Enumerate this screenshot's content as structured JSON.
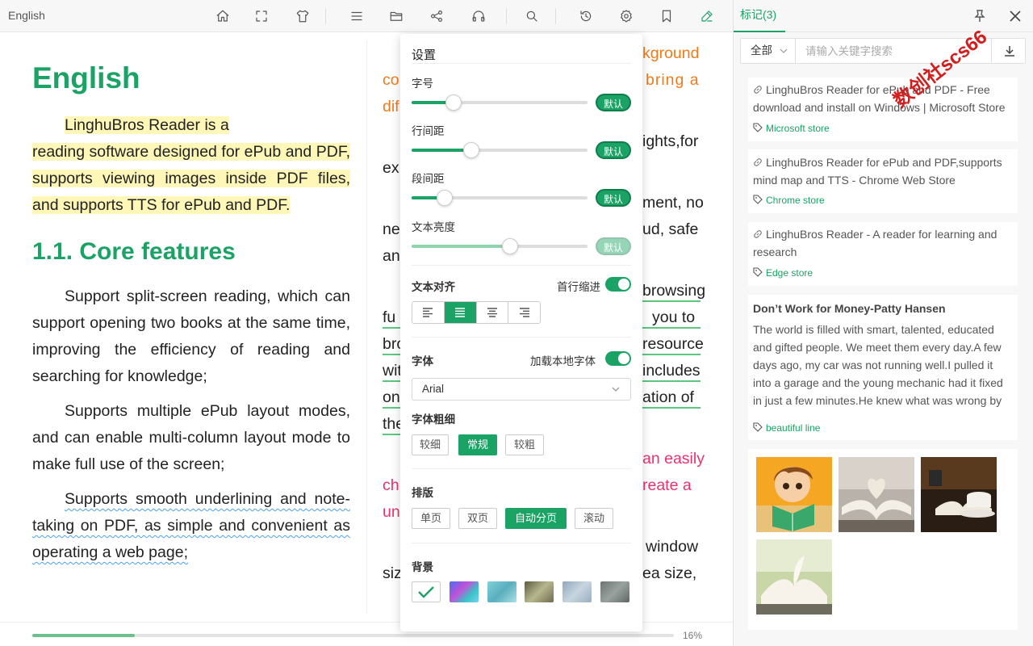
{
  "topbar": {
    "title": "English",
    "icons": [
      "home-icon",
      "fullscreen-icon",
      "theme-icon",
      "menu-icon",
      "folder-icon",
      "share-icon",
      "headphones-icon",
      "search-icon",
      "history-icon",
      "settings-icon",
      "bookmark-icon",
      "pen-icon"
    ]
  },
  "reader": {
    "heading": "English",
    "intro_first": "LinghuBros Reader is a",
    "intro_rest": "reading software designed for ePub and PDF, supports viewing images inside PDF files, and supports TTS for ePub and PDF.",
    "subheading": "1.1. Core features",
    "p1": "Support split-screen reading, which can support opening two books at the same time, improving the efficiency of reading and searching for knowledge;",
    "p2": "Supports multiple ePub layout modes, and can enable multi-column layout mode to make full use of the screen;",
    "p3": "Supports smooth underlining and note-taking on PDF, as simple and convenient as operating a web page;",
    "right_fragments": {
      "r1": "kground",
      "r2a": "co",
      "r2b": "bring a",
      "r3": "dif",
      "r4": "ights,for",
      "r5": "ex",
      "r6": "ment, no",
      "r7a": "ne",
      "r7b": "ud, safe",
      "r8": "an",
      "r9": "browsing",
      "r10a": "fu",
      "r10b": "you to",
      "r11a": "bro",
      "r11b": "resource",
      "r12a": "wit",
      "r12b": "includes",
      "r13a": "on",
      "r13b": "ation of",
      "r14": "the",
      "r15": "an easily",
      "r16a": "ch",
      "r16b": "reate a",
      "r17": "un",
      "r18": "window",
      "r19a": "siz",
      "r19b": "ea size,"
    }
  },
  "progress": {
    "percent_label": "16%",
    "fraction": 0.16
  },
  "settings": {
    "title": "设置",
    "font_size_label": "字号",
    "line_spacing_label": "行间距",
    "para_spacing_label": "段间距",
    "brightness_label": "文本亮度",
    "default_label": "默认",
    "sliders": {
      "font_size": 0.24,
      "line_spacing": 0.34,
      "para_spacing": 0.19,
      "brightness": 0.56
    },
    "text_align_label": "文本对齐",
    "first_indent_label": "首行缩进",
    "font_label": "字体",
    "load_local_font_label": "加载本地字体",
    "font_value": "Arial",
    "font_weight_label": "字体粗细",
    "weights": [
      "较细",
      "常规",
      "较粗"
    ],
    "layout_label": "排版",
    "layouts": [
      "单页",
      "双页",
      "自动分页",
      "滚动"
    ],
    "background_label": "背景"
  },
  "panel": {
    "title": "标记(3)",
    "filter_label": "全部",
    "search_placeholder": "请输入关键字搜索",
    "cards": [
      {
        "text": "LinghuBros Reader for ePub and PDF - Free download and install on Windows | Microsoft Store",
        "tag": "Microsoft store"
      },
      {
        "text": "LinghuBros Reader for ePub and PDF,supports mind map and TTS - Chrome Web Store",
        "tag": "Chrome store"
      },
      {
        "text": "LinghuBros Reader - A reader for learning and research",
        "tag": "Edge store"
      }
    ],
    "note": {
      "title": "Don’t Work for Money-Patty Hansen",
      "text": "The world is filled with smart, talented, educated and gifted people. We meet them every day.A few days ago, my car was not running well.I pulled it into a garage and the young mechanic had it fixed in just a few minutes.He knew what was wrong by simpl…",
      "tag": "beautiful line"
    }
  },
  "watermark": "数创社scs66",
  "colors": {
    "accent": "#1aa365",
    "orange": "#f27a1a",
    "pink": "#e8336d"
  }
}
